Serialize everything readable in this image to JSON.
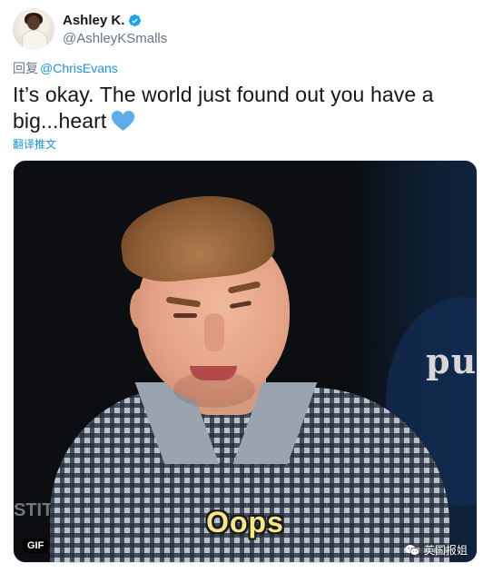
{
  "user": {
    "display_name": "Ashley K.",
    "handle": "@AshleyKSmalls",
    "verified": true
  },
  "reply": {
    "prefix": "回复",
    "mention": "@ChrisEvans"
  },
  "tweet": {
    "text": "It’s okay. The world just found out you have a big...heart",
    "emoji": "blue-heart"
  },
  "translate_label": "翻译推文",
  "media": {
    "type": "gif",
    "badge": "GIF",
    "subtitle": "Oops",
    "background_text": "pu",
    "edge_text": "STIT",
    "watermark": "英国报姐"
  },
  "colors": {
    "link": "#1b95e0",
    "secondary_text": "#657786",
    "primary_text": "#14171a",
    "heart": "#5dadec",
    "verified": "#1da1f2"
  }
}
